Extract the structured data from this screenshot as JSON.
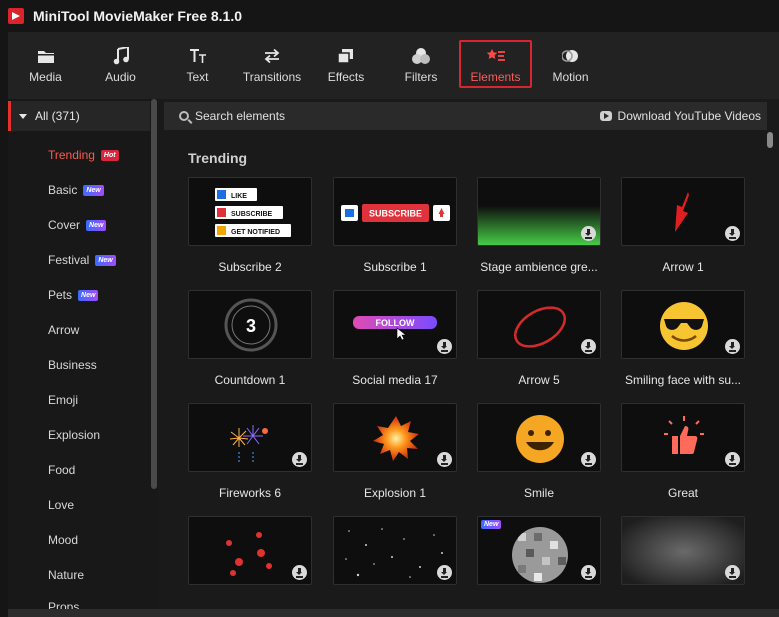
{
  "app": {
    "title": "MiniTool MovieMaker Free 8.1.0"
  },
  "toolbar": {
    "items": [
      {
        "label": "Media",
        "icon": "folder-icon"
      },
      {
        "label": "Audio",
        "icon": "music-note-icon"
      },
      {
        "label": "Text",
        "icon": "text-icon"
      },
      {
        "label": "Transitions",
        "icon": "transitions-arrows-icon"
      },
      {
        "label": "Effects",
        "icon": "effects-layers-icon"
      },
      {
        "label": "Filters",
        "icon": "filters-circles-icon"
      },
      {
        "label": "Elements",
        "icon": "elements-icon",
        "active": true
      },
      {
        "label": "Motion",
        "icon": "motion-icon"
      }
    ]
  },
  "sidebar": {
    "all_label": "All (371)",
    "categories": [
      {
        "label": "Trending",
        "badge": "Hot",
        "active": true
      },
      {
        "label": "Basic",
        "badge": "New"
      },
      {
        "label": "Cover",
        "badge": "New"
      },
      {
        "label": "Festival",
        "badge": "New"
      },
      {
        "label": "Pets",
        "badge": "New"
      },
      {
        "label": "Arrow"
      },
      {
        "label": "Business"
      },
      {
        "label": "Emoji"
      },
      {
        "label": "Explosion"
      },
      {
        "label": "Food"
      },
      {
        "label": "Love"
      },
      {
        "label": "Mood"
      },
      {
        "label": "Nature"
      },
      {
        "label": "Props"
      }
    ]
  },
  "search": {
    "placeholder": "Search elements"
  },
  "youtube": {
    "label": "Download YouTube Videos"
  },
  "section": {
    "title": "Trending"
  },
  "cards": {
    "subscribe2": {
      "label": "Subscribe 2",
      "like": "LIKE",
      "subscribe": "SUBSCRIBE",
      "notify": "GET NOTIFIED"
    },
    "subscribe1": {
      "label": "Subscribe 1",
      "subscribe": "SUBSCRIBE"
    },
    "stage": {
      "label": "Stage ambience gre..."
    },
    "arrow1": {
      "label": "Arrow 1"
    },
    "countdown": {
      "label": "Countdown 1",
      "number": "3"
    },
    "social17": {
      "label": "Social media 17",
      "follow": "FOLLOW"
    },
    "arrow5": {
      "label": "Arrow 5"
    },
    "smiling": {
      "label": "Smiling face with su..."
    },
    "fireworks": {
      "label": "Fireworks 6"
    },
    "explosion": {
      "label": "Explosion 1"
    },
    "smile": {
      "label": "Smile"
    },
    "great": {
      "label": "Great"
    },
    "row4": {
      "new_badge": "New"
    }
  },
  "colors": {
    "accent": "#e5312b",
    "hot_badge": "#d7263d",
    "subscribe_red": "#e0323a",
    "like_blue": "#1d6fe0",
    "follow_pink": "#e04bb3",
    "follow_purple": "#7a4bff"
  }
}
